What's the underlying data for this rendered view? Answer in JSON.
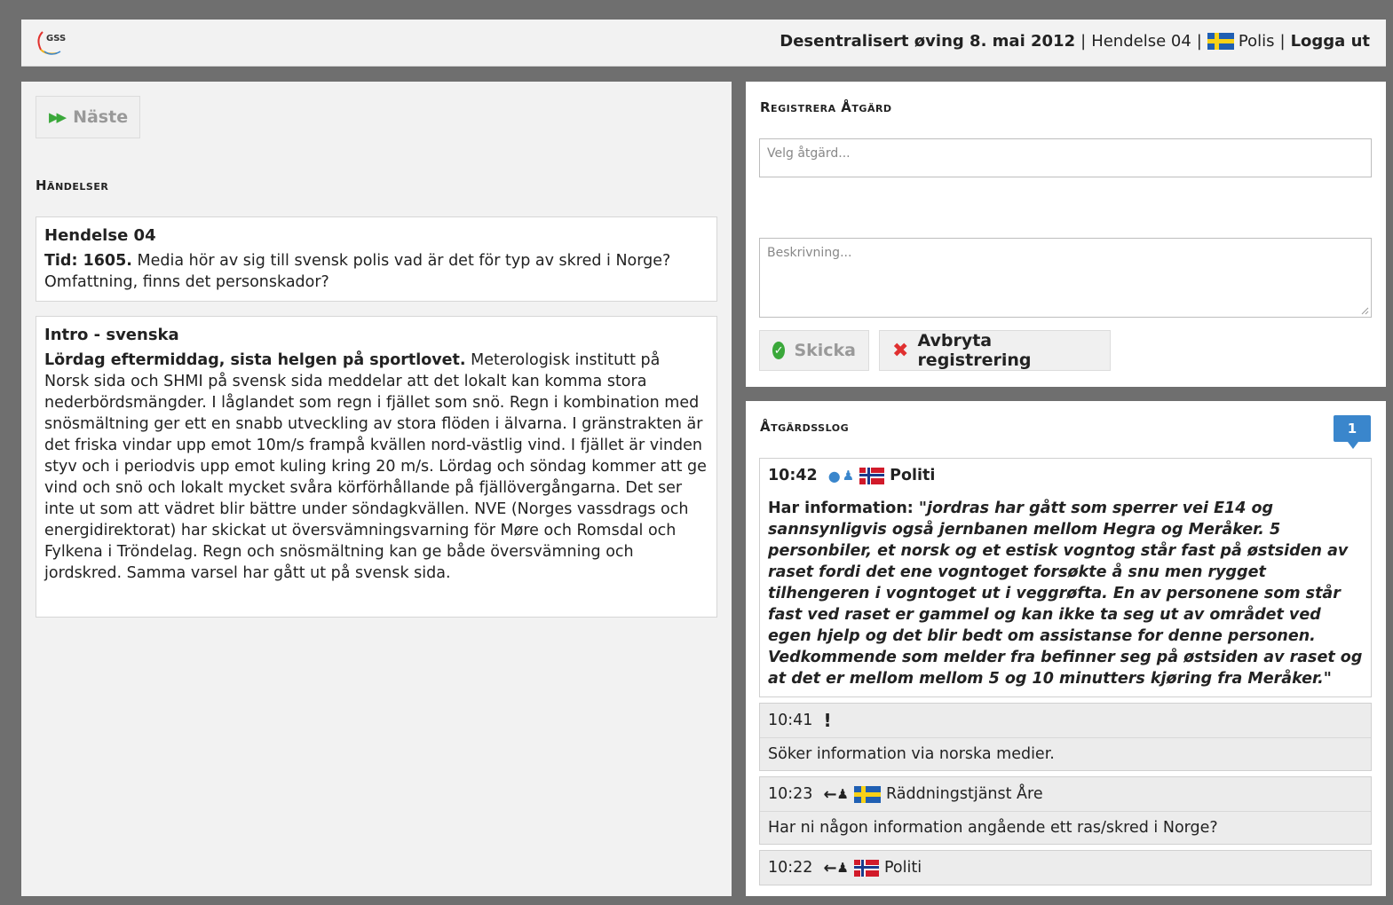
{
  "header": {
    "exercise": "Desentralisert øving 8. mai 2012",
    "separator": "|",
    "event": "Hendelse 04",
    "role": "Polis",
    "logout": "Logga ut",
    "logo_text": "GSS"
  },
  "left": {
    "next_button": "Näste",
    "events_title": "Händelser",
    "event_card": {
      "title": "Hendelse 04",
      "time_label": "Tid: 1605.",
      "text": " Media hör av sig till svensk polis vad är det för typ av skred i Norge? Omfattning, finns det personskador?"
    },
    "intro_card": {
      "title": "Intro - svenska",
      "lead": "Lördag eftermiddag, sista helgen på sportlovet.",
      "text": " Meterologisk institutt på Norsk sida och SHMI på svensk sida meddelar att det lokalt kan komma stora nederbördsmängder. I låglandet som regn i fjället som snö. Regn i kombination med snösmältning ger ett en snabb utveckling av stora flöden i älvarna. I gränstrakten är det friska vindar upp emot 10m/s frampå kvällen nord-västlig vind. I fjället är vinden styv och i periodvis upp emot kuling kring 20 m/s. Lördag och söndag kommer att ge vind och snö och lokalt mycket svåra körförhållande på fjällövergångarna. Det ser inte ut som att vädret blir bättre under söndagkvällen. NVE (Norges vassdrags och energidirektorat) har skickat ut översvämningsvarning för Møre och Romsdal och Fylkena i Tröndelag. Regn och snösmältning kan ge både översvämning och jordskred. Samma varsel har gått ut på svensk sida."
    }
  },
  "register": {
    "title": "Registrera Åtgärd",
    "action_placeholder": "Velg åtgärd...",
    "description_placeholder": "Beskrivning...",
    "send_button": "Skicka",
    "cancel_button": "Avbryta registrering"
  },
  "log": {
    "title": "Åtgärdsslog",
    "badge_count": "1",
    "entries": [
      {
        "time": "10:42",
        "org": "Politi",
        "label": "Har information:",
        "quote": " \"jordras har gått som sperrer vei E14 og sannsynligvis også jernbanen mellom Hegra og Meråker. 5 personbiler, et norsk og et estisk vogntog står fast på østsiden av raset fordi det ene vogntoget forsøkte å snu men rygget tilhengeren i vogntoget ut i veggrøfta. En av personene som står fast ved raset er gammel og kan ikke ta seg ut av området ved egen hjelp og det blir bedt om assistanse for denne personen. Vedkommende som melder fra befinner seg på østsiden av raset og at det er mellom mellom 5 og 10 minutters kjøring fra Meråker.\""
      },
      {
        "time": "10:41",
        "icon": "!",
        "text": "Söker information via norska medier."
      },
      {
        "time": "10:23",
        "org": "Räddningstjänst Åre",
        "text": "Har ni någon information angående ett ras/skred i Norge?"
      },
      {
        "time": "10:22",
        "org": "Politi"
      }
    ]
  },
  "colors": {
    "background": "#6f6f6f",
    "accent_blue": "#3a86cc",
    "success_green": "#3aa83a",
    "danger_red": "#e03030"
  }
}
